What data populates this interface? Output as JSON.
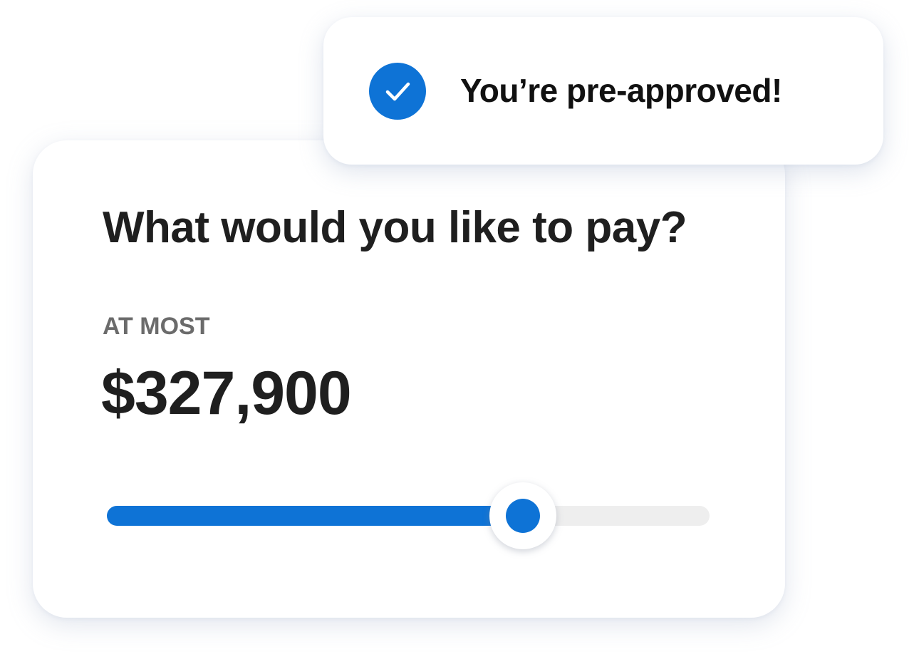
{
  "toast": {
    "icon": "checkmark-icon",
    "message": "You’re pre-approved!"
  },
  "card": {
    "question": "What would you like to pay?",
    "label": "AT MOST",
    "amount": "$327,900"
  },
  "slider": {
    "value_fraction": 0.69
  },
  "colors": {
    "accent": "#0e73d6",
    "track": "#eeeeee",
    "text_dark": "#1f1f1f",
    "text_muted": "#6b6b6b"
  }
}
